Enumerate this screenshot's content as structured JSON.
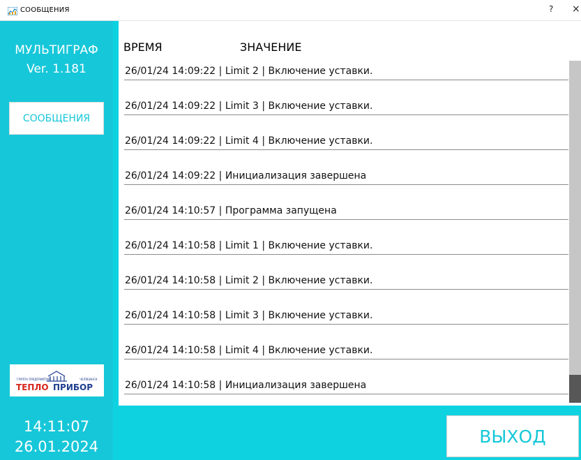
{
  "window": {
    "title": "СООБЩЕНИЯ",
    "help": "?",
    "close": "×",
    "icon": "chart-icon"
  },
  "sidebar": {
    "app_name": "МУЛЬТИГРАФ",
    "version": "Ver. 1.181",
    "messages_button": "СООБЩЕНИЯ",
    "logo": {
      "group_text": "ГРУППА ПРЕДПРИЯТИЙ",
      "city": "ЧЕЛЯБИНСК",
      "brand_a": "ТЕПЛО",
      "brand_b": "ПРИБОР"
    }
  },
  "table": {
    "headers": {
      "time": "ВРЕМЯ",
      "value": "ЗНАЧЕНИЕ"
    },
    "rows": [
      "26/01/24 14:09:22 | Limit 2 | Включение уставки.",
      "26/01/24 14:09:22 | Limit 3 | Включение уставки.",
      "26/01/24 14:09:22 | Limit 4 | Включение уставки.",
      "26/01/24 14:09:22 | Инициализация завершена",
      "26/01/24 14:10:57 | Программа запущена",
      "26/01/24 14:10:58 | Limit 1 | Включение уставки.",
      "26/01/24 14:10:58 | Limit 2 | Включение уставки.",
      "26/01/24 14:10:58 | Limit 3 | Включение уставки.",
      "26/01/24 14:10:58 | Limit 4 | Включение уставки.",
      "26/01/24 14:10:58 | Инициализация завершена"
    ]
  },
  "clock": {
    "time": "14:11:07",
    "date": "26.01.2024"
  },
  "exit_button": "ВЫХОД",
  "colors": {
    "accent": "#16c7d9",
    "accent_light": "#0fd2e0",
    "logo_red": "#d7261e",
    "logo_blue": "#1f3f8f"
  }
}
